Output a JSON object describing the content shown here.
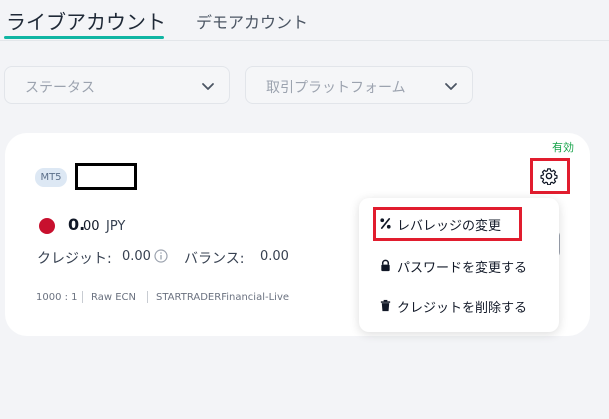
{
  "tabs": {
    "live": "ライブアカウント",
    "demo": "デモアカウント"
  },
  "filters": {
    "status_placeholder": "ステータス",
    "platform_placeholder": "取引プラットフォーム"
  },
  "account": {
    "status": "有効",
    "platform": "MT5",
    "balance_int": "0.",
    "balance_dec": "00",
    "currency": "JPY",
    "credit_label": "クレジット:",
    "credit_value": "0.00",
    "balance_label": "バランス:",
    "balance_value": "0.00",
    "leverage": "1000 : 1",
    "account_type": "Raw ECN",
    "server": "STARTRADERFinancial-Live"
  },
  "menu": {
    "items": [
      {
        "label": "レバレッジの変更",
        "icon": "percent-icon"
      },
      {
        "label": "パスワードを変更する",
        "icon": "lock-icon"
      },
      {
        "label": "クレジットを削除する",
        "icon": "trash-icon"
      }
    ]
  },
  "colors": {
    "accent": "#10b5a3",
    "status_green": "#16a34a",
    "highlight_red": "#e11d2e",
    "flag_red": "#c8102e"
  }
}
